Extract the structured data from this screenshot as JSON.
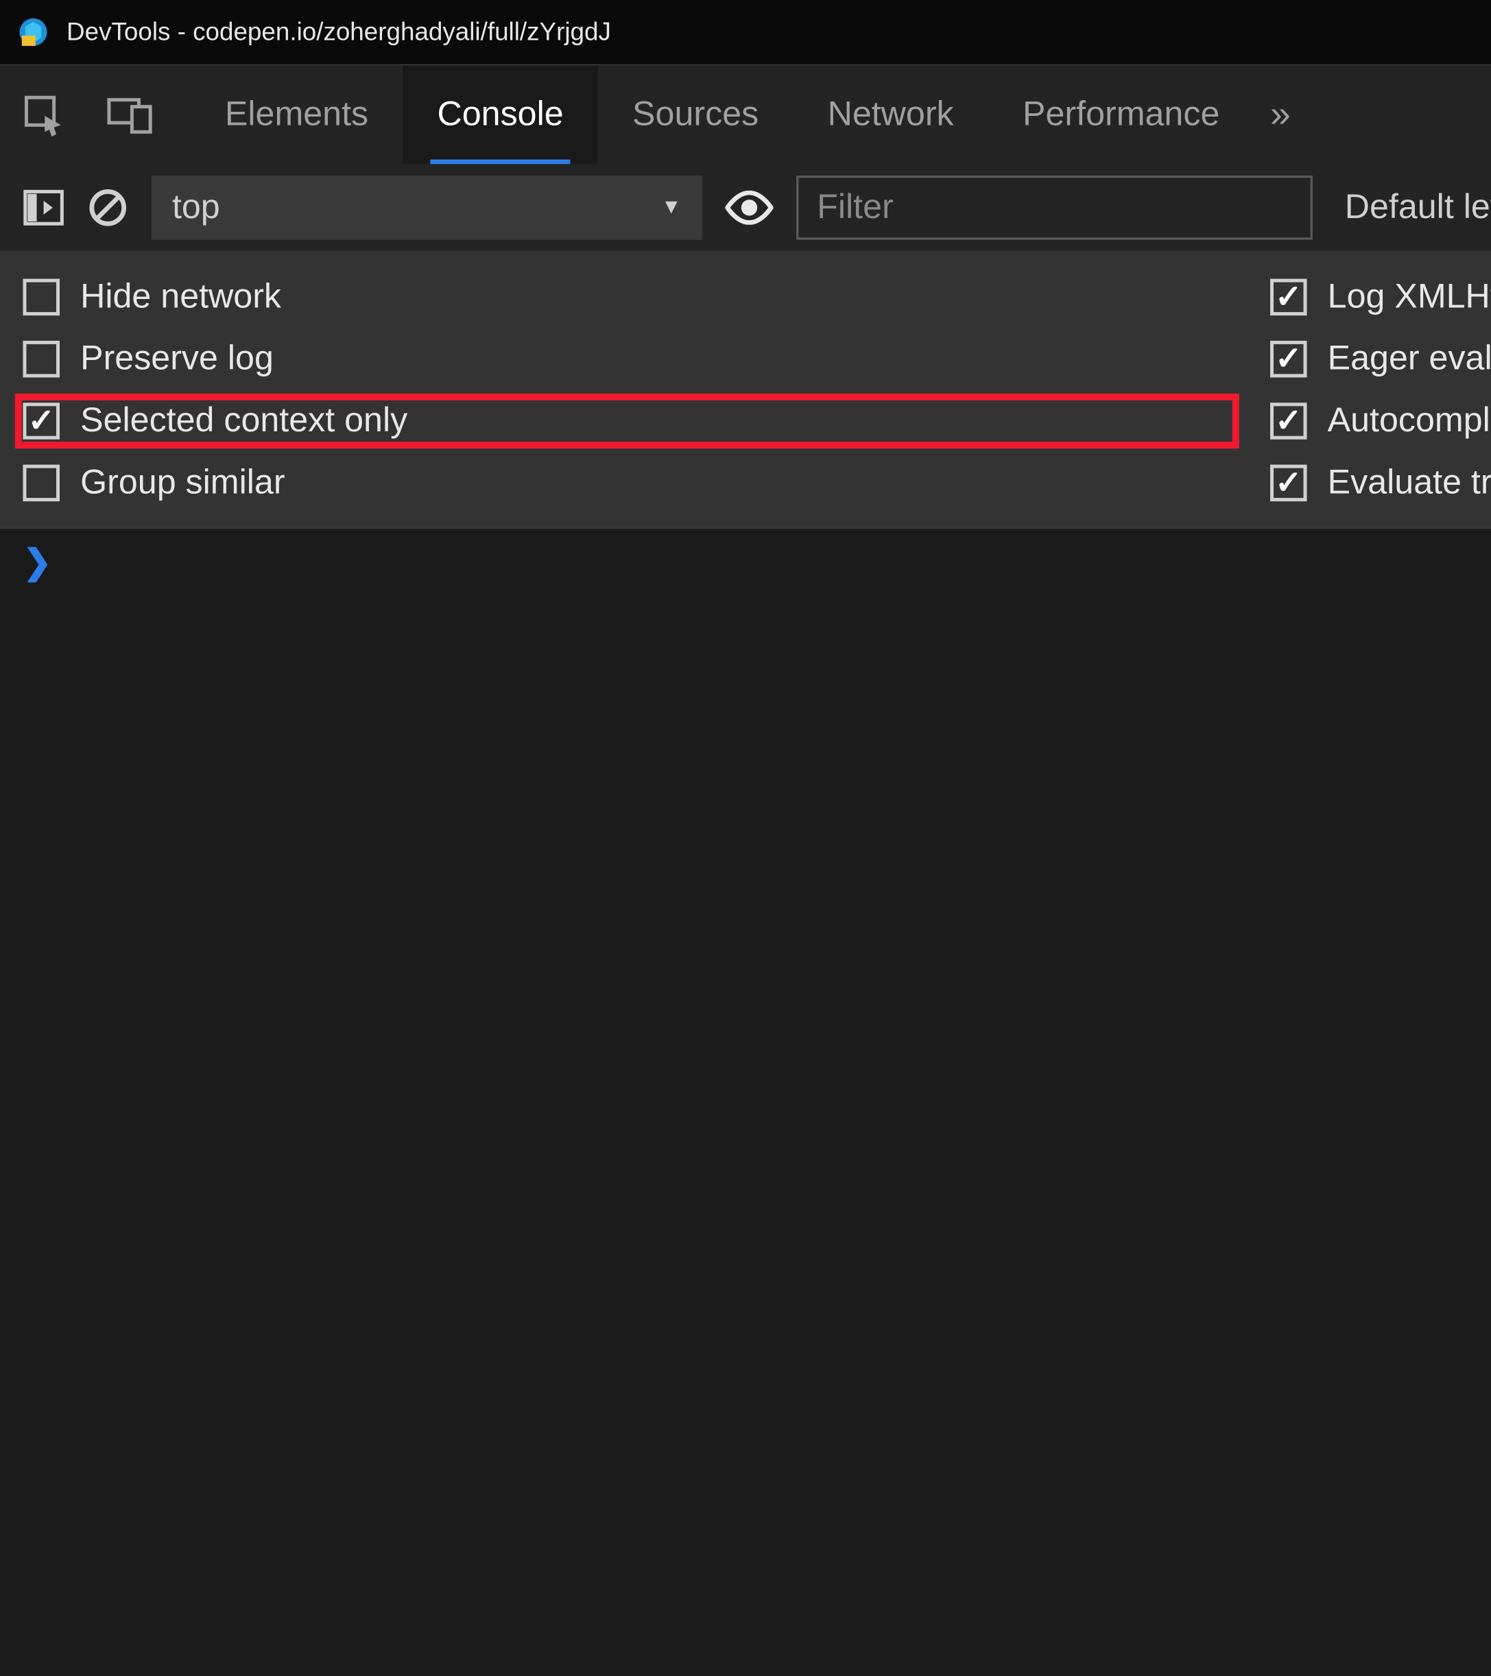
{
  "window": {
    "title": "DevTools - codepen.io/zoherghadyali/full/zYrjgdJ"
  },
  "tabs": {
    "items": [
      "Elements",
      "Console",
      "Sources",
      "Network",
      "Performance"
    ],
    "active": "Console",
    "overflow_glyph": "»"
  },
  "console_toolbar": {
    "context": "top",
    "filter_placeholder": "Filter",
    "levels_label": "Default levels"
  },
  "settings": {
    "left": [
      {
        "label": "Hide network",
        "checked": false,
        "highlighted": false
      },
      {
        "label": "Preserve log",
        "checked": false,
        "highlighted": false
      },
      {
        "label": "Selected context only",
        "checked": true,
        "highlighted": true
      },
      {
        "label": "Group similar",
        "checked": false,
        "highlighted": false
      }
    ],
    "right": [
      {
        "label": "Log XMLHttpRequests",
        "checked": true,
        "highlighted": false
      },
      {
        "label": "Eager evaluation",
        "checked": true,
        "highlighted": false
      },
      {
        "label": "Autocomplete from history",
        "checked": true,
        "highlighted": false
      },
      {
        "label": "Evaluate triggers user activation",
        "checked": true,
        "highlighted": false
      }
    ]
  },
  "prompt_glyph": "❯",
  "colors": {
    "accent_blue": "#2b7de9",
    "highlight_red": "#ef1a2e"
  }
}
